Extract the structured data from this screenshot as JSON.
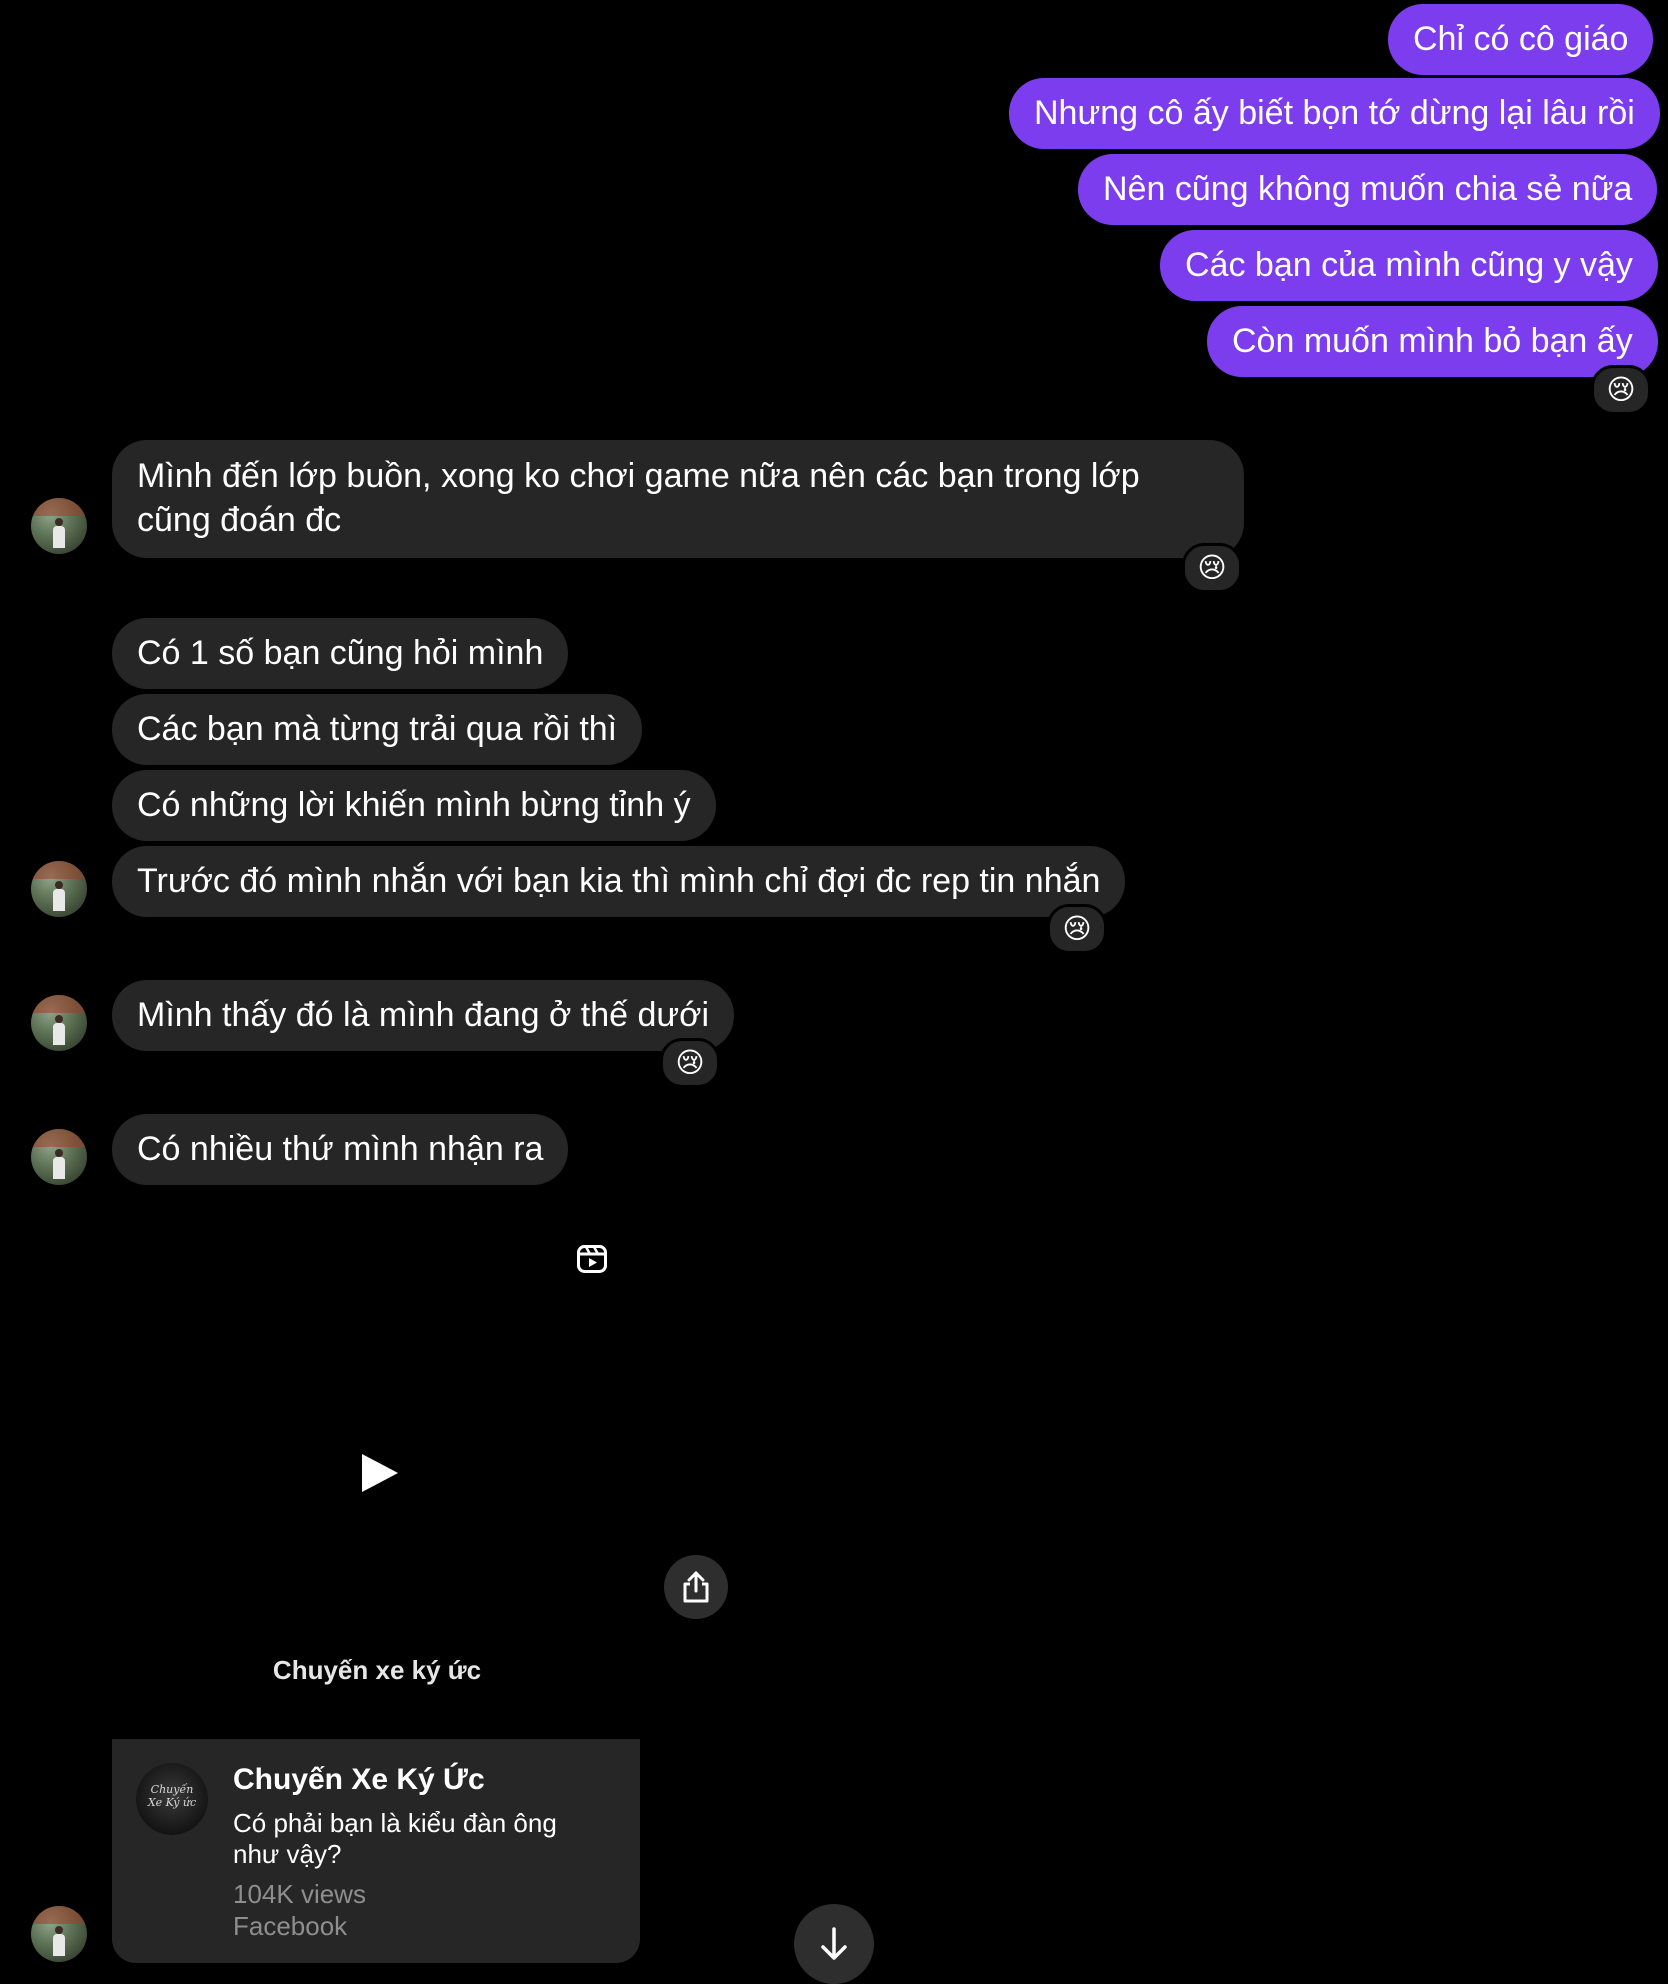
{
  "colors": {
    "background": "#000000",
    "outgoing_bubble": "#7c3dee",
    "incoming_bubble": "#262626",
    "secondary_text": "#8e8e8e"
  },
  "outgoing_messages": [
    {
      "text": "Chỉ có cô giáo"
    },
    {
      "text": "Nhưng cô ấy biết bọn tớ dừng lại lâu rồi"
    },
    {
      "text": "Nên cũng không muốn chia sẻ nữa"
    },
    {
      "text": "Các bạn của mình cũng y vậy"
    },
    {
      "text": "Còn muốn mình bỏ bạn ấy",
      "reaction": "😢"
    }
  ],
  "incoming_messages": [
    {
      "text": "Mình đến lớp buồn, xong ko chơi game nữa nên các bạn trong lớp cũng đoán đc",
      "reaction": "😢"
    },
    {
      "text": "Có 1 số bạn cũng hỏi mình"
    },
    {
      "text": "Các bạn mà từng trải qua rồi thì"
    },
    {
      "text": "Có những lời khiến mình bừng tỉnh ý"
    },
    {
      "text": "Trước đó mình nhắn với bạn kia thì mình chỉ đợi đc rep tin nhắn",
      "reaction": "😢"
    },
    {
      "text": "Mình thấy đó là mình đang ở thế dưới",
      "reaction": "😢"
    },
    {
      "text": "Có nhiều thứ mình nhận ra"
    }
  ],
  "reel": {
    "icon": "reels-icon",
    "play_icon": "play-icon",
    "share_icon": "share-icon",
    "caption": "Chuyến xe ký ức"
  },
  "link_preview": {
    "avatar_text": "Chuyến Xe Ký ức",
    "title": "Chuyến Xe Ký Ức",
    "description": "Có phải bạn là kiểu đàn ông như vậy?",
    "views": "104K views",
    "source": "Facebook"
  },
  "scroll_button": {
    "icon": "arrow-down-icon"
  }
}
